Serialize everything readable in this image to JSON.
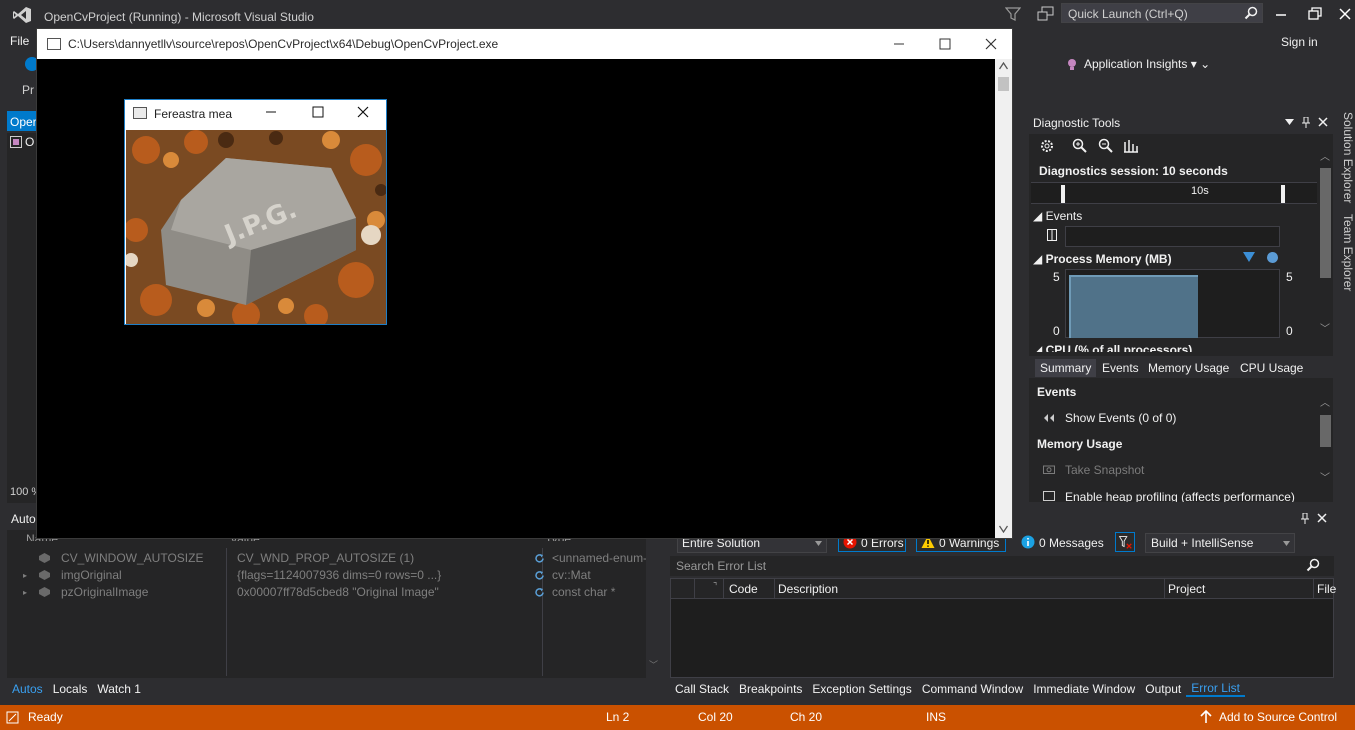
{
  "vs": {
    "title": "OpenCvProject (Running) - Microsoft Visual Studio",
    "quick_launch_placeholder": "Quick Launch (Ctrl+Q)",
    "menu_file": "File",
    "sign_in": "Sign in",
    "app_insights": "Application Insights",
    "toolbar_stub": "Pr",
    "left_tab": "Oper",
    "left_item": "O",
    "zoom": "100 %"
  },
  "console": {
    "title": "C:\\Users\\dannyetllv\\source\\repos\\OpenCvProject\\x64\\Debug\\OpenCvProject.exe"
  },
  "cv_window": {
    "title": "Fereastra mea",
    "image_text": "J.P.G."
  },
  "diagnostics": {
    "title": "Diagnostic Tools",
    "session": "Diagnostics session: 10 seconds",
    "ruler_label": "10s",
    "events_head": "Events",
    "mem_head": "Process Memory (MB)",
    "mem_axis_max": "5",
    "mem_axis_min": "0",
    "mem_fill_fraction": 0.6,
    "cpu_head": "CPU (% of all processors)",
    "tabs": [
      "Summary",
      "Events",
      "Memory Usage",
      "CPU Usage"
    ],
    "summary": {
      "events_head": "Events",
      "show_events": "Show Events (0 of 0)",
      "memory_head": "Memory Usage",
      "take_snapshot": "Take Snapshot",
      "heap_profiling": "Enable heap profiling (affects performance)"
    }
  },
  "vertical_tabs": [
    "Solution Explorer",
    "Team Explorer"
  ],
  "autos": {
    "title": "Autos",
    "columns": [
      "Name",
      "Value",
      "Type"
    ],
    "rows": [
      {
        "name": "CV_WINDOW_AUTOSIZE",
        "value": "CV_WND_PROP_AUTOSIZE (1)",
        "type": "<unnamed-enum-"
      },
      {
        "name": "imgOriginal",
        "value": "{flags=1124007936 dims=0 rows=0 ...}",
        "type": "cv::Mat"
      },
      {
        "name": "pzOriginalImage",
        "value": "0x00007ff78d5cbed8 \"Original Image\"",
        "type": "const char *"
      }
    ],
    "tabs": [
      "Autos",
      "Locals",
      "Watch 1"
    ]
  },
  "error_list": {
    "scope": "Entire Solution",
    "errors": "0 Errors",
    "warnings": "0 Warnings",
    "messages": "0 Messages",
    "build": "Build + IntelliSense",
    "search_placeholder": "Search Error List",
    "columns": [
      "Code",
      "Description",
      "Project",
      "File"
    ],
    "tabs": [
      "Call Stack",
      "Breakpoints",
      "Exception Settings",
      "Command Window",
      "Immediate Window",
      "Output",
      "Error List"
    ]
  },
  "status": {
    "ready": "Ready",
    "ln": "Ln 2",
    "col": "Col 20",
    "ch": "Ch 20",
    "ins": "INS",
    "source_control": "Add to Source Control"
  },
  "colors": {
    "status_bar": "#ca5100",
    "accent": "#007acc",
    "chart_fill": "#507289"
  }
}
